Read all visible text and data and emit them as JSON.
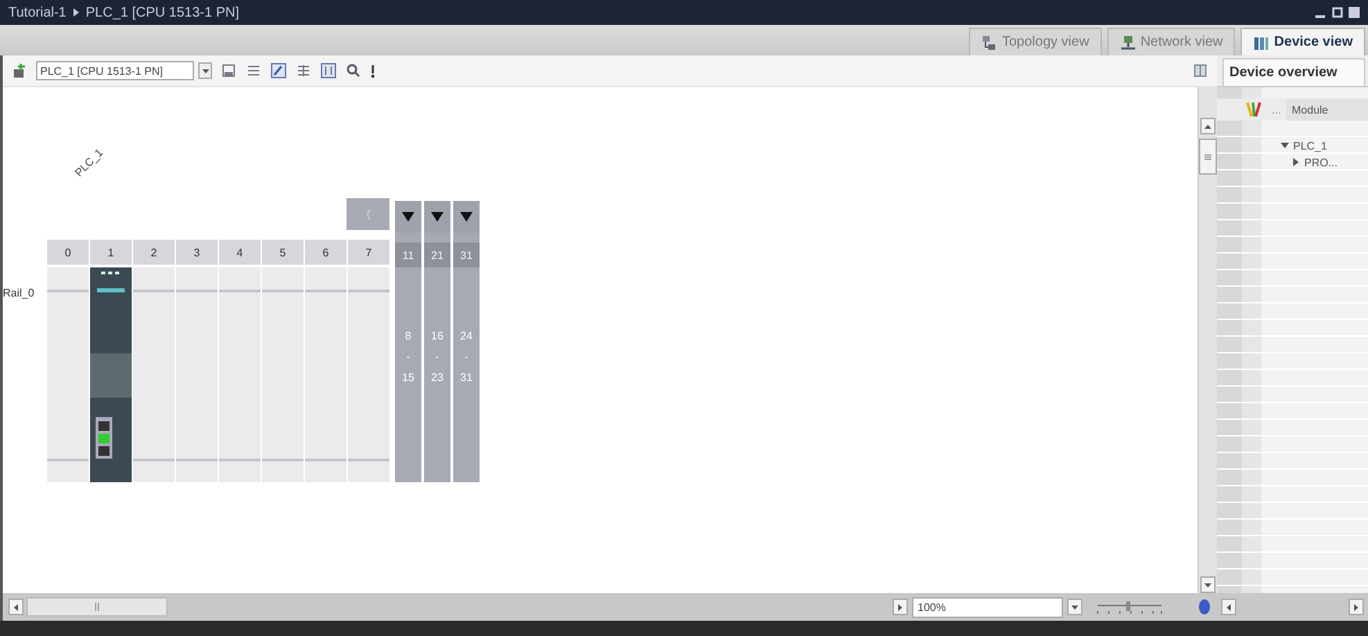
{
  "window": {
    "breadcrumb": [
      "Tutorial-1",
      "PLC_1 [CPU 1513-1 PN]"
    ]
  },
  "view_tabs": [
    {
      "label": "Topology view",
      "kind": "topology",
      "selected": false
    },
    {
      "label": "Network view",
      "kind": "network",
      "selected": false
    },
    {
      "label": "Device view",
      "kind": "device",
      "selected": true
    }
  ],
  "toolbar": {
    "device_select": "PLC_1 [CPU 1513-1 PN]"
  },
  "rack": {
    "device_label": "PLC_1",
    "rail_label": "Rail_0",
    "slots": [
      {
        "label": "0",
        "occupied": false
      },
      {
        "label": "1",
        "occupied": true
      },
      {
        "label": "2",
        "occupied": false
      },
      {
        "label": "3",
        "occupied": false
      },
      {
        "label": "4",
        "occupied": false
      },
      {
        "label": "5",
        "occupied": false
      },
      {
        "label": "6",
        "occupied": false
      },
      {
        "label": "7",
        "occupied": false
      }
    ],
    "expansions": [
      {
        "header": "11",
        "range_start": "8",
        "range_sep": "-",
        "range_end": "15"
      },
      {
        "header": "21",
        "range_start": "16",
        "range_sep": "-",
        "range_end": "23"
      },
      {
        "header": "31",
        "range_start": "24",
        "range_sep": "-",
        "range_end": "31"
      }
    ]
  },
  "zoom": {
    "value": "100%",
    "level": 0.5
  },
  "device_overview": {
    "tab": "Device overview",
    "columns": [
      "...",
      "Module"
    ],
    "tree": [
      {
        "label": "PLC_1",
        "expanded": true,
        "children": [
          {
            "label": "PRO...",
            "expanded": false
          }
        ]
      }
    ]
  }
}
